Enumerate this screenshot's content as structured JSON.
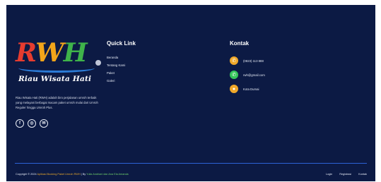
{
  "brand": {
    "logo_letters": [
      "R",
      "W",
      "H"
    ],
    "logo_subtitle": "Riau Wisata Hati",
    "description": "Riau Wisata Hati (RWH) adalah biro perjalanan umroh terbaik yang melayani berbagai macam paket umroh mulai dari Umroh Reguler hingga Umroh Plus.",
    "colors": {
      "r": "#e63c2f",
      "w": "#f2a51a",
      "h": "#3fb34a",
      "arc": "#2b7bd6"
    },
    "socials": [
      {
        "name": "facebook-icon",
        "glyph": "f"
      },
      {
        "name": "instagram-icon",
        "glyph": "◎"
      },
      {
        "name": "email-icon",
        "glyph": "✉"
      }
    ]
  },
  "quick": {
    "title": "Quick Link",
    "links": [
      "Beranda",
      "Tentang Kami",
      "Paket",
      "Galeri"
    ]
  },
  "contact": {
    "title": "Kontak",
    "items": [
      {
        "icon": "phone-icon",
        "glyph": "✆",
        "color": "#f0a82a",
        "text": "(0823) 113 888"
      },
      {
        "icon": "whatsapp-icon",
        "glyph": "✆",
        "color": "#35c65a",
        "text": "rwh@gmail.com"
      },
      {
        "icon": "location-icon",
        "glyph": "●",
        "color": "#f0a82a",
        "text": "Kota Dumai"
      }
    ]
  },
  "bottom": {
    "copyright_prefix": "Copyright © 2024",
    "site_name": "Aplikasi Booking Paket Umroh RWH",
    "by": "| By",
    "authors": "Yulia Andriani dan Ana Ela Amanda",
    "links": [
      "Login",
      "Registrasi",
      "Kontak"
    ]
  },
  "colors": {
    "footer_bg": "#0c1a44",
    "divider": "#2c62d6"
  }
}
